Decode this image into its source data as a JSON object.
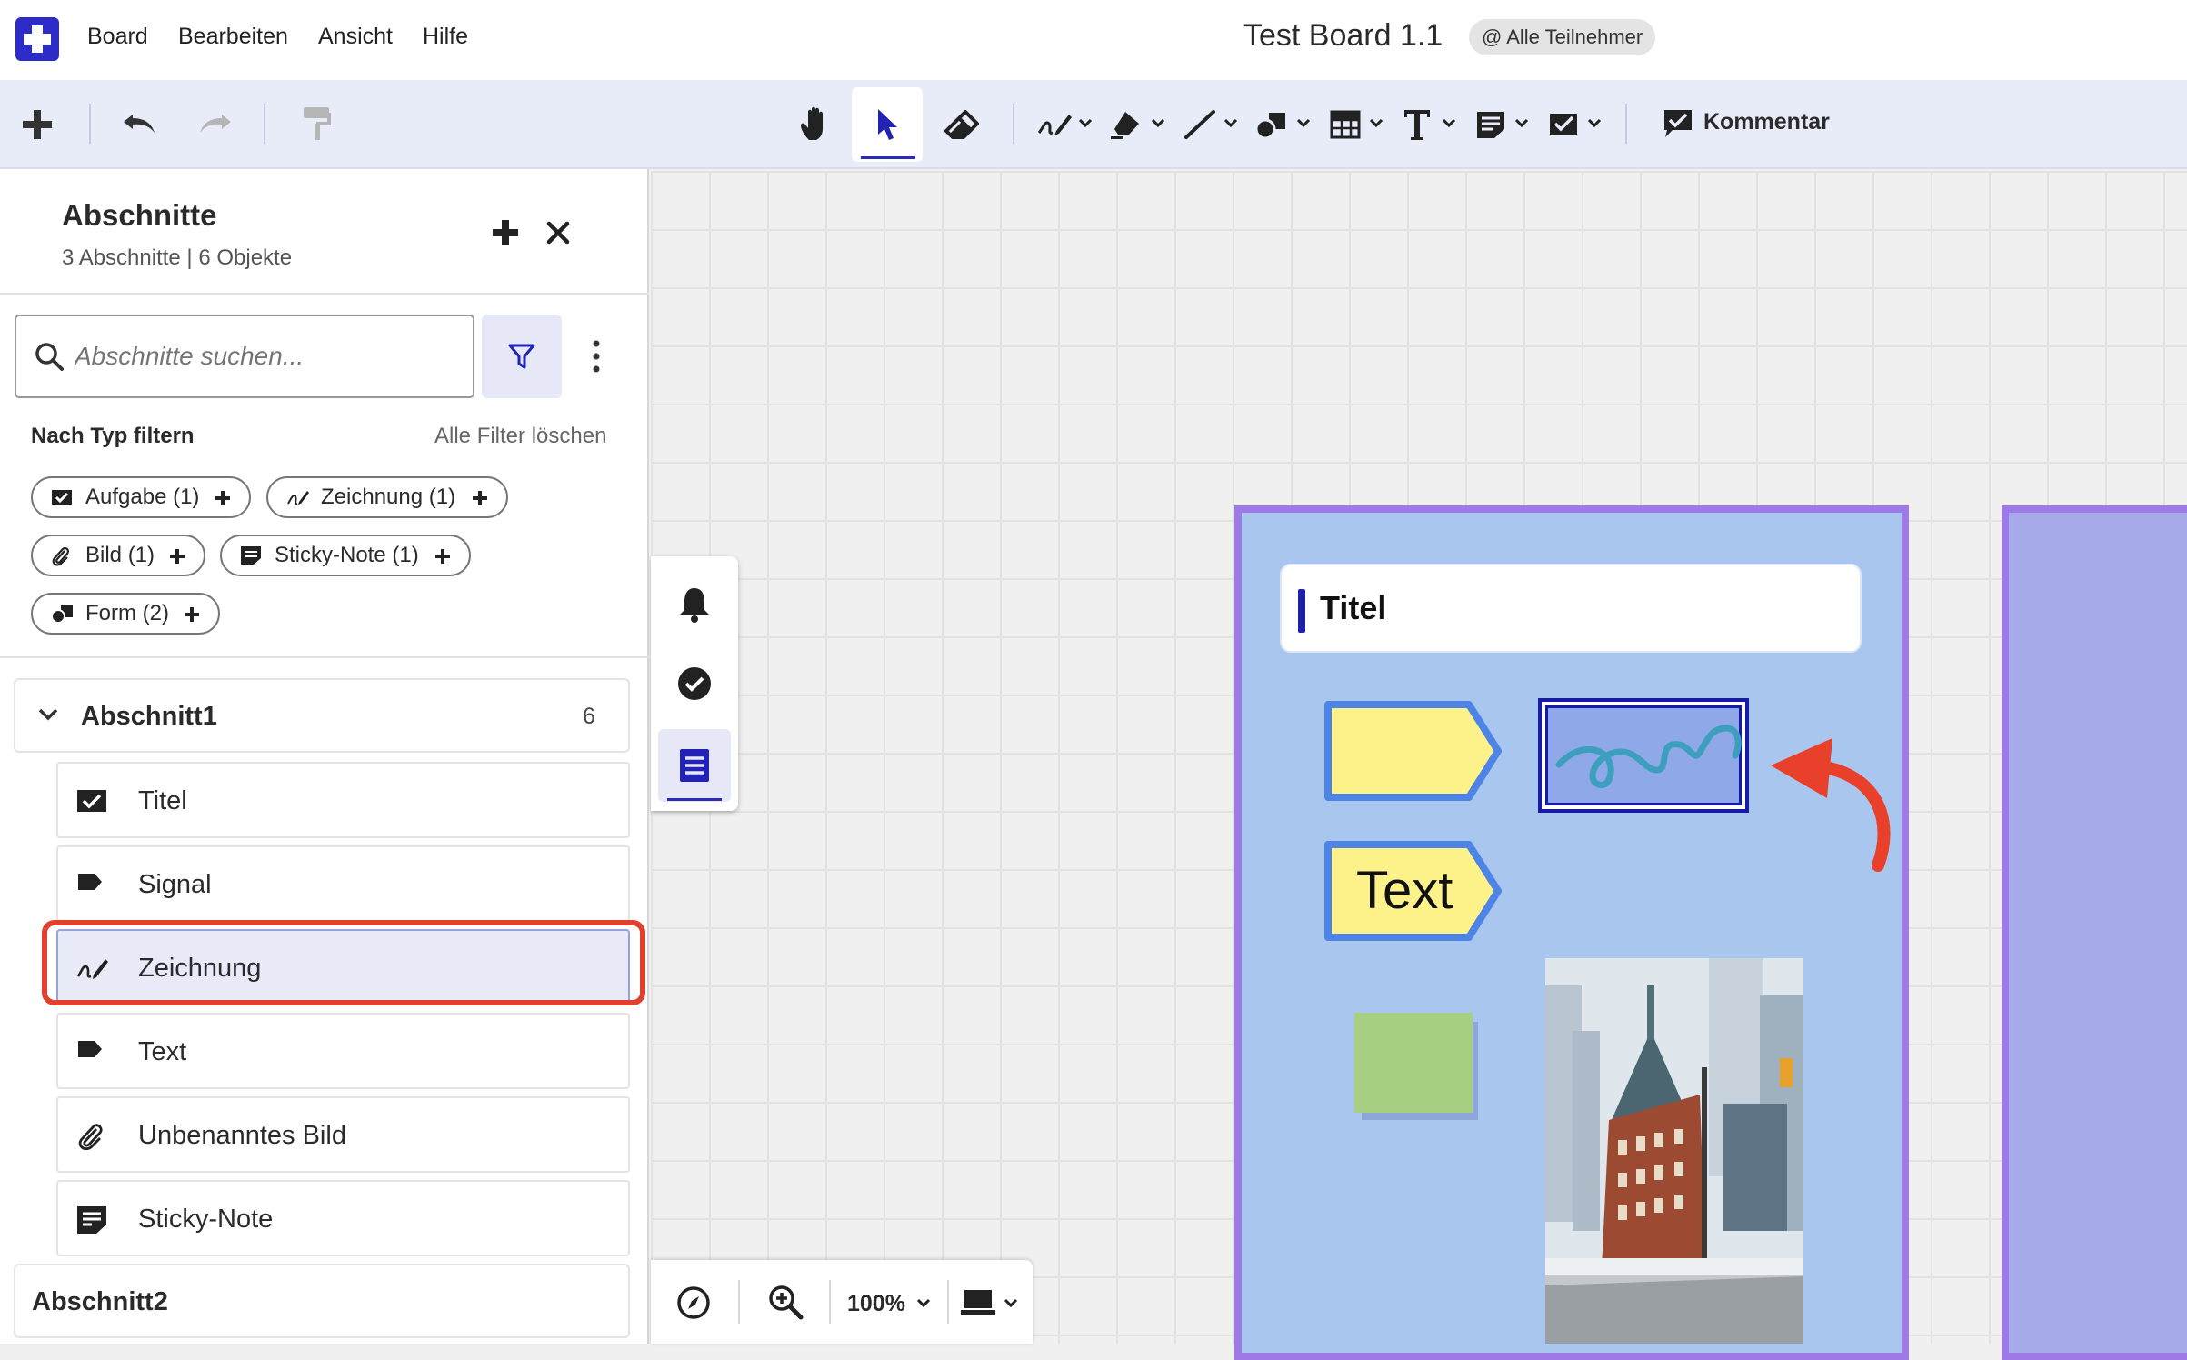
{
  "menubar": {
    "items": [
      "Board",
      "Bearbeiten",
      "Ansicht",
      "Hilfe"
    ],
    "board_title": "Test Board 1.1",
    "participants": "@ Alle Teilnehmer"
  },
  "toolbar": {
    "left_icons": [
      "plus-icon",
      "undo-icon",
      "redo-icon",
      "format-painter-icon"
    ],
    "tools": [
      "hand-icon",
      "select-pointer-icon",
      "eraser-icon",
      "pen-icon",
      "highlighter-icon",
      "line-icon",
      "shapes-icon",
      "table-icon",
      "text-icon",
      "sticky-note-icon",
      "task-icon"
    ],
    "active_tool": "select-pointer-icon",
    "comment_label": "Kommentar"
  },
  "sidebar": {
    "title": "Abschnitte",
    "subtitle": "3 Abschnitte | 6 Objekte",
    "search_placeholder": "Abschnitte suchen...",
    "filter_label": "Nach Typ filtern",
    "clear_filters": "Alle Filter löschen",
    "chips": [
      {
        "label": "Aufgabe (1)",
        "icon": "task-icon"
      },
      {
        "label": "Zeichnung (1)",
        "icon": "pen-icon"
      },
      {
        "label": "Bild (1)",
        "icon": "paperclip-icon"
      },
      {
        "label": "Sticky-Note (1)",
        "icon": "sticky-note-icon"
      },
      {
        "label": "Form (2)",
        "icon": "shapes-icon"
      }
    ],
    "section1": {
      "label": "Abschnitt1",
      "count": "6",
      "items": [
        {
          "label": "Titel",
          "icon": "task-icon"
        },
        {
          "label": "Signal",
          "icon": "tag-icon"
        },
        {
          "label": "Zeichnung",
          "icon": "pen-icon",
          "selected": true
        },
        {
          "label": "Text",
          "icon": "tag-icon"
        },
        {
          "label": "Unbenanntes Bild",
          "icon": "paperclip-icon"
        },
        {
          "label": "Sticky-Note",
          "icon": "sticky-note-icon"
        }
      ]
    },
    "section2": {
      "label": "Abschnitt2"
    }
  },
  "float_panel": {
    "icons": [
      "bell-icon",
      "check-circle-icon",
      "sections-list-icon"
    ],
    "active": "sections-list-icon"
  },
  "zoombar": {
    "zoom": "100%",
    "icons": [
      "compass-icon",
      "zoom-in-icon",
      "device-icon"
    ]
  },
  "board": {
    "title_card_text": "Titel",
    "text_tag": "Text",
    "colors": {
      "frame_fill": "#a9c6ee",
      "frame_border": "#9d7ae6",
      "tag_fill": "#fdf189",
      "tag_border": "#4d84e6",
      "sticky": "#a6cf82",
      "arrow": "#e8402a"
    }
  }
}
